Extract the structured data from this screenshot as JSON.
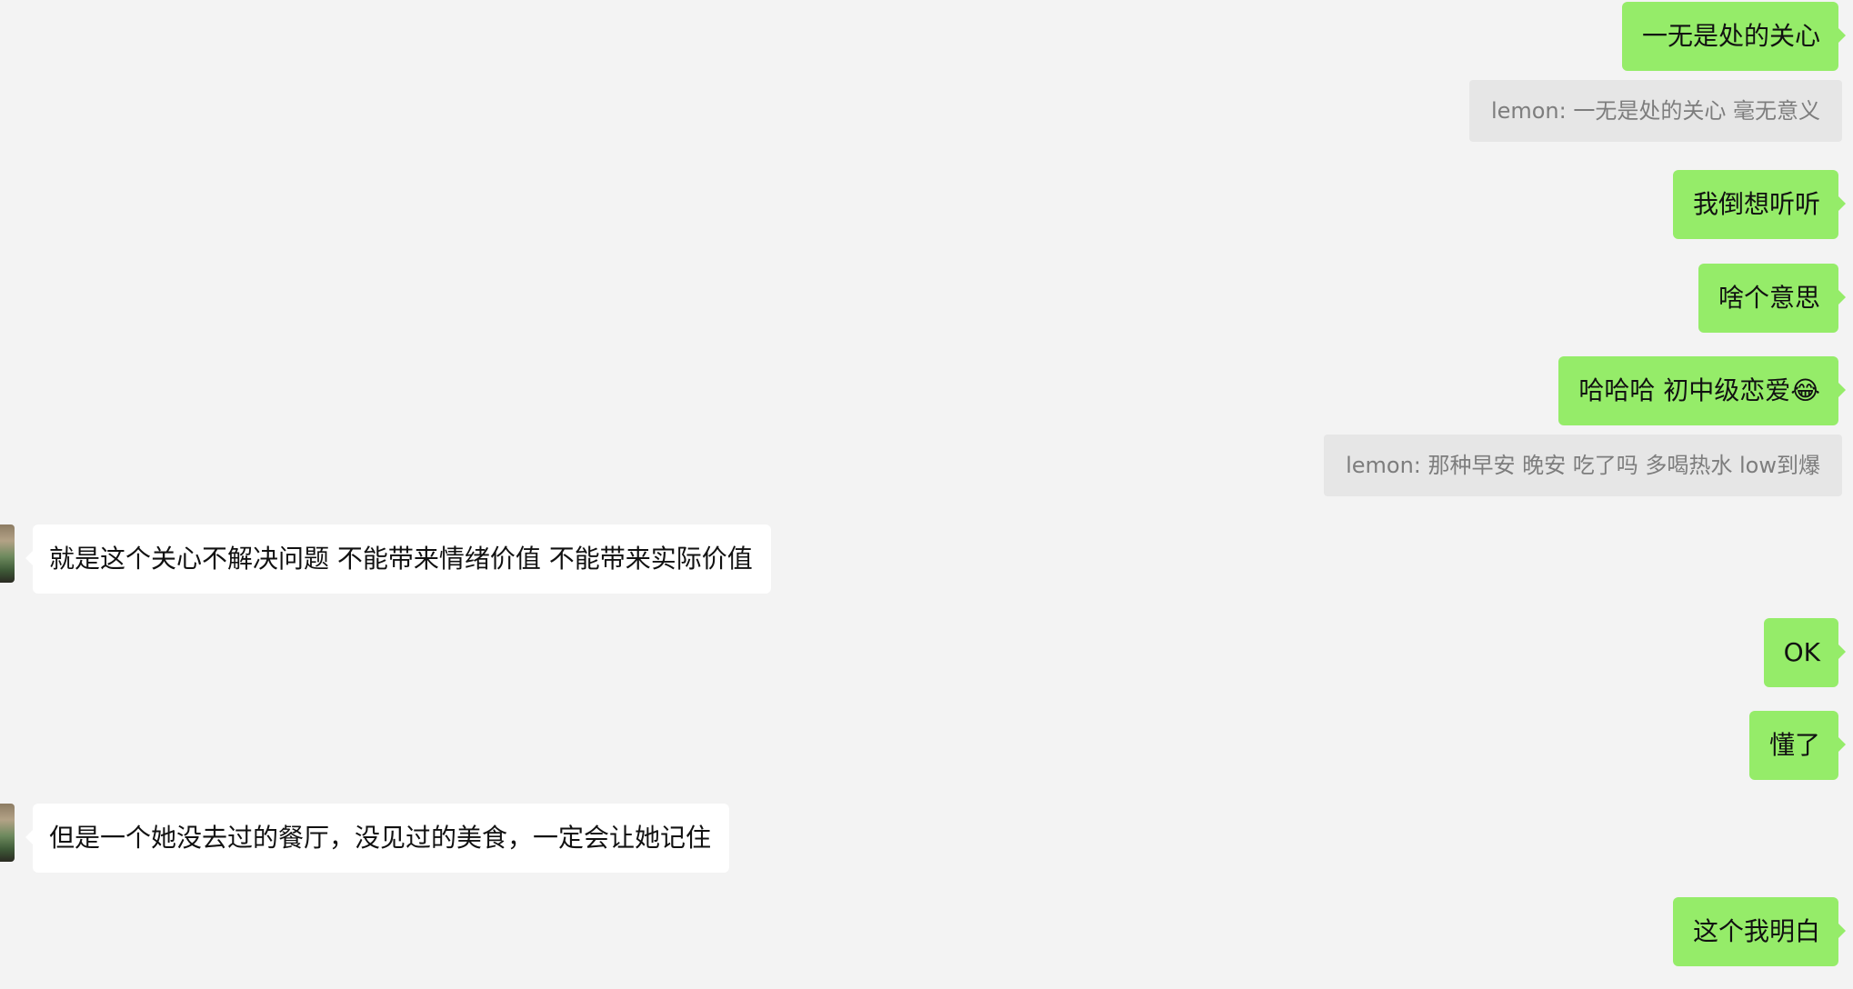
{
  "messages": [
    {
      "direction": "out",
      "text": "一无是处的关心"
    },
    {
      "direction": "quote",
      "sender": "lemon",
      "text": "lemon: 一无是处的关心 毫无意义"
    },
    {
      "direction": "out",
      "text": "我倒想听听"
    },
    {
      "direction": "out",
      "text": "啥个意思"
    },
    {
      "direction": "out",
      "text": "哈哈哈  初中级恋爱",
      "emoji": "😂"
    },
    {
      "direction": "quote",
      "sender": "lemon",
      "text": "lemon: 那种早安 晚安 吃了吗  多喝热水 low到爆"
    },
    {
      "direction": "in",
      "text": "就是这个关心不解决问题 不能带来情绪价值 不能带来实际价值"
    },
    {
      "direction": "out",
      "text": "OK"
    },
    {
      "direction": "out",
      "text": "懂了"
    },
    {
      "direction": "in",
      "text": "但是一个她没去过的餐厅，没见过的美食，一定会让她记住"
    },
    {
      "direction": "out",
      "text": "这个我明白"
    }
  ],
  "colors": {
    "background": "#f3f3f3",
    "outgoing_bubble": "#95ec69",
    "incoming_bubble": "#ffffff",
    "quote_box": "#e6e6e6",
    "quote_text": "#7d7d7d"
  }
}
